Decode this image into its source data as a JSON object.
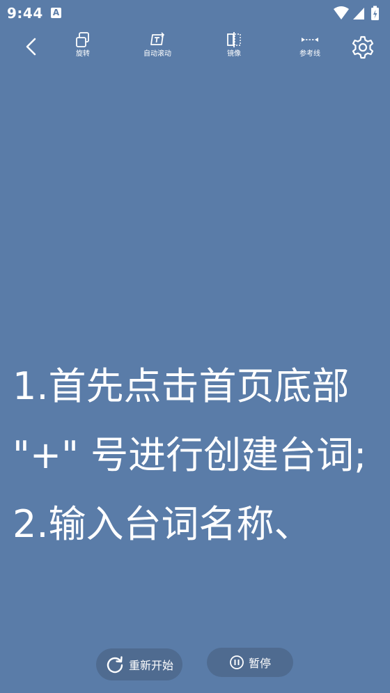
{
  "status_bar": {
    "time": "9:44",
    "notification_glyph": "A",
    "icons": [
      "wifi-icon",
      "cellular-signal-icon",
      "battery-icon"
    ]
  },
  "toolbar": {
    "back_icon": "chevron-left-icon",
    "tools": [
      {
        "label": "旋转",
        "icon": "rotate-icon"
      },
      {
        "label": "自动滚动",
        "icon": "auto-scroll-icon"
      },
      {
        "label": "镜像",
        "icon": "mirror-icon"
      },
      {
        "label": "参考线",
        "icon": "guide-line-icon"
      }
    ],
    "settings_icon": "gear-icon"
  },
  "prompt": {
    "text": "1.首先点击首页底部 \"+\" 号进行创建台词;\n2.输入台词名称、"
  },
  "controls": {
    "restart_label": "重新开始",
    "restart_icon": "refresh-icon",
    "pause_label": "暂停",
    "pause_icon": "pause-icon"
  },
  "colors": {
    "background": "#5a7ca8",
    "button_background": "#4f6b90",
    "text": "#ffffff"
  }
}
